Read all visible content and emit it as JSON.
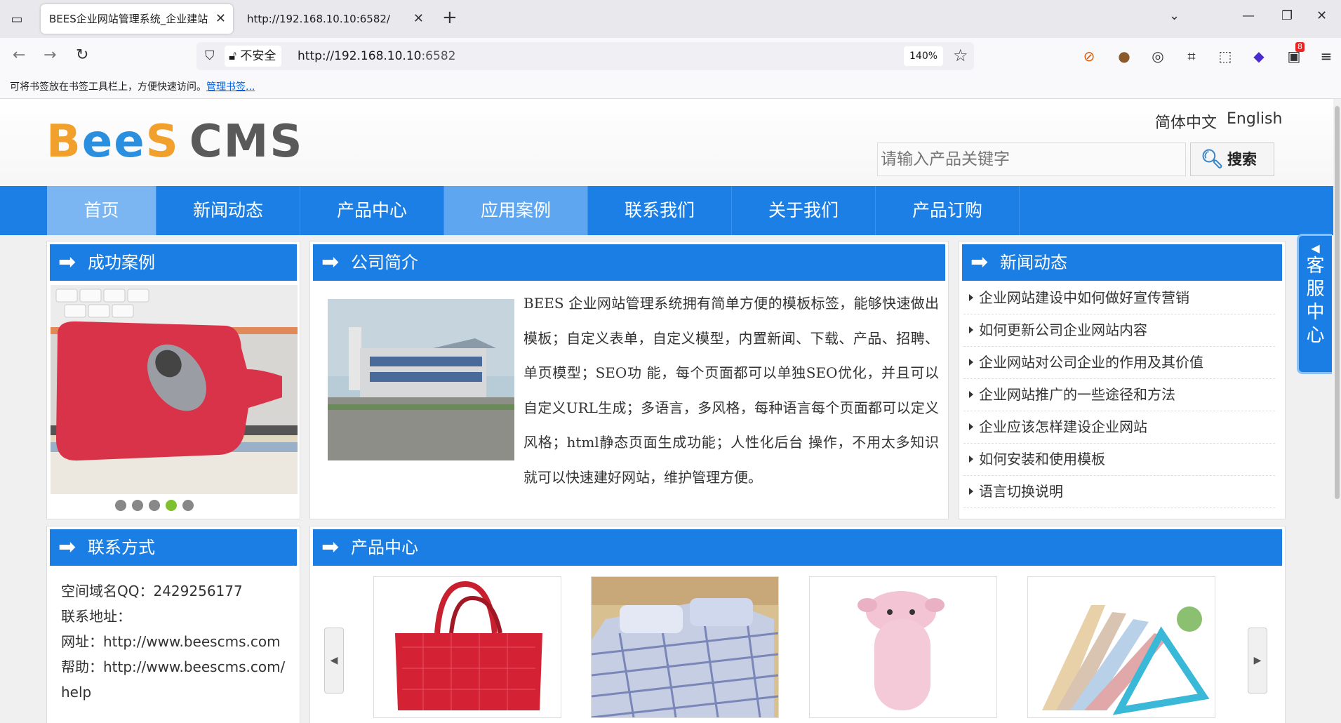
{
  "browser": {
    "tabs": [
      {
        "title": "BEES企业网站管理系统_企业建站系统",
        "active": true
      },
      {
        "title": "http://192.168.10.10:6582/",
        "active": false
      }
    ],
    "security_label": "不安全",
    "url_host": "http://192.168.10.10",
    "url_port": ":6582",
    "zoom": "140%",
    "extension_badge": "8",
    "bookmark_hint": "可将书签放在书签工具栏上，方便快速访问。",
    "bookmark_manage": "管理书签..."
  },
  "site": {
    "logo_text": {
      "b": "B",
      "e": "ee",
      "s": "S",
      "cms": "CMS"
    },
    "lang_zh": "简体中文",
    "lang_en": "English",
    "search_placeholder": "请输入产品关键字",
    "search_button": "搜索",
    "menu": [
      "首页",
      "新闻动态",
      "产品中心",
      "应用案例",
      "联系我们",
      "关于我们",
      "产品订购"
    ],
    "cases_title": "成功案例",
    "intro_title": "公司简介",
    "intro_text": "BEES 企业网站管理系统拥有简单方便的模板标签，能够快速做出模板；自定义表单，自定义模型，内置新闻、下载、产品、招聘、单页模型；SEO功 能，每个页面都可以单独SEO优化，并且可以自定义URL生成；多语言，多风格，每种语言每个页面都可以定义风格；html静态页面生成功能；人性化后台 操作，不用太多知识就可以快速建好网站，维护管理方便。",
    "news_title": "新闻动态",
    "news_items": [
      "企业网站建设中如何做好宣传营销",
      "如何更新公司企业网站内容",
      "企业网站对公司企业的作用及其价值",
      "企业网站推广的一些途径和方法",
      "企业应该怎样建设企业网站",
      "如何安装和使用模板",
      "语言切换说明"
    ],
    "contact_title": "联系方式",
    "contact_lines": [
      "空间域名QQ：2429256177",
      "联系地址：",
      "网址：http://www.beescms.com",
      "帮助：http://www.beescms.com/",
      "help"
    ],
    "products_title": "产品中心",
    "kefu_text": [
      "客",
      "服",
      "中",
      "心"
    ]
  },
  "colors": {
    "brand_blue": "#1b7ee4",
    "menu_active": "#5fa6f0",
    "dot_active": "#7ec02d"
  }
}
